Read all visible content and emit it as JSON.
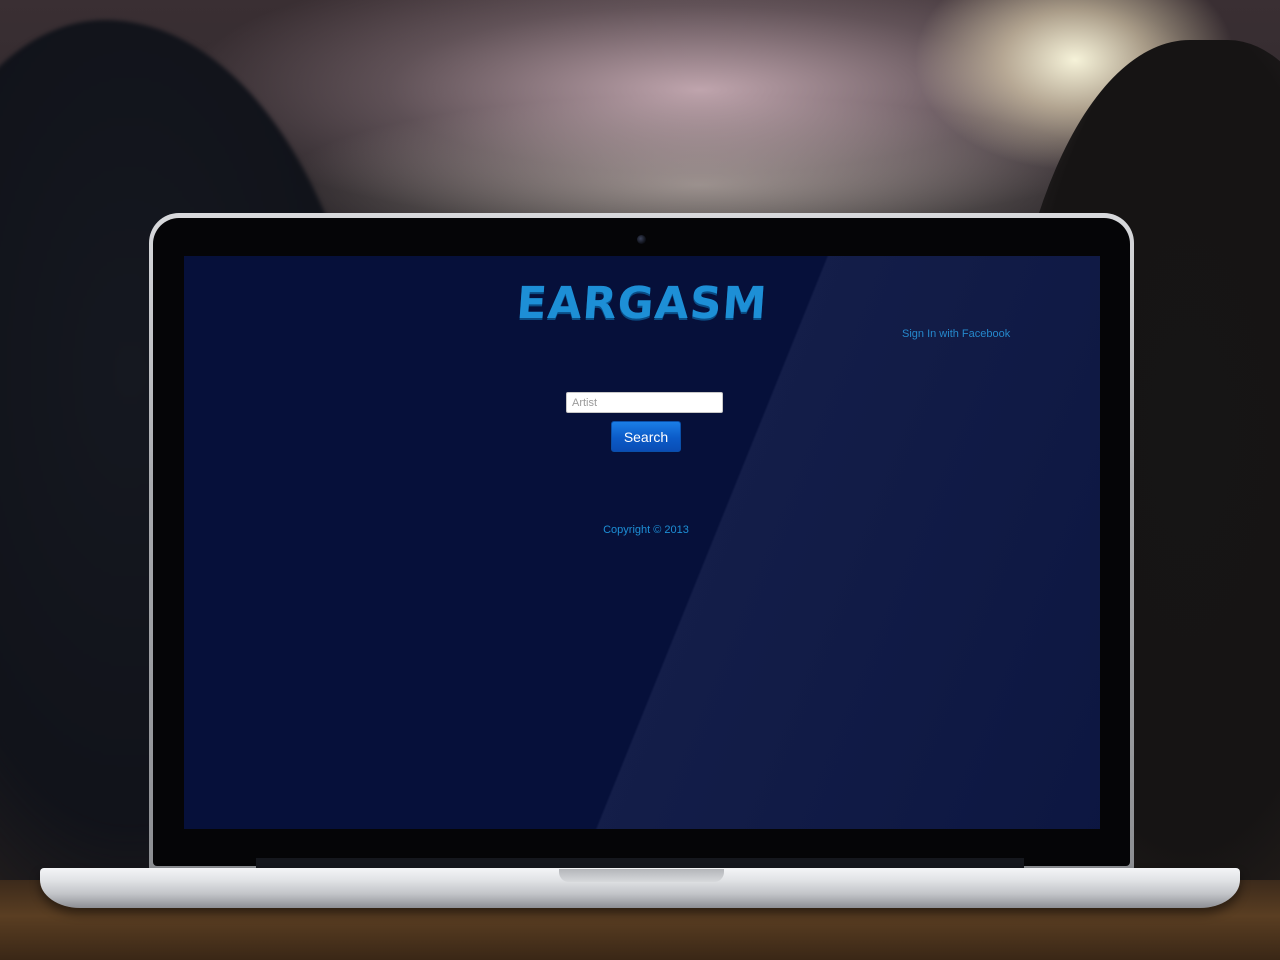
{
  "app": {
    "logo_text": "EARGASM",
    "sign_in_label": "Sign In with Facebook"
  },
  "search": {
    "placeholder": "Artist",
    "value": "",
    "button_label": "Search"
  },
  "footer": {
    "copyright": "Copyright © 2013"
  },
  "colors": {
    "page_background": "#06103a",
    "accent": "#1d8fd6",
    "button": "#0b5bc8"
  }
}
